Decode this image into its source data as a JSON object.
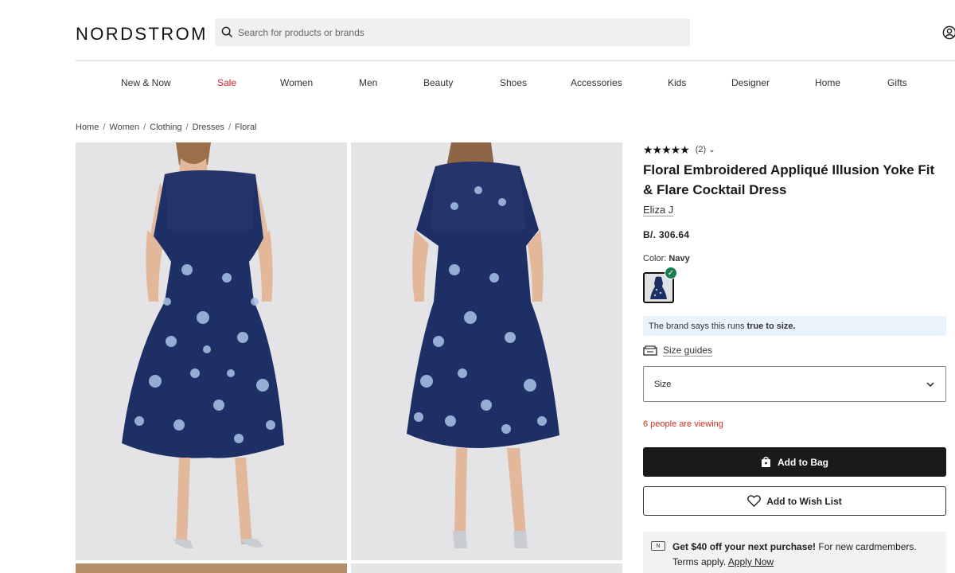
{
  "header": {
    "logo": "NORDSTROM",
    "search_placeholder": "Search for products or brands",
    "account_icon": "account-icon"
  },
  "nav": [
    "New & Now",
    "Sale",
    "Women",
    "Men",
    "Beauty",
    "Shoes",
    "Accessories",
    "Kids",
    "Designer",
    "Home",
    "Gifts"
  ],
  "breadcrumb": [
    "Home",
    "Women",
    "Clothing",
    "Dresses",
    "Floral"
  ],
  "breadcrumb_sep": "/",
  "product": {
    "stars": "★★★★★",
    "rating_value": 5,
    "review_count": "(2)",
    "title": "Floral Embroidered Appliqué Illusion Yoke Fit & Flare Cocktail Dress",
    "brand": "Eliza J",
    "price": "B/. 306.64",
    "color_label": "Color:",
    "color_value": "Navy",
    "fit_text": "The brand says this runs",
    "fit_bold": "true to size.",
    "size_guides": "Size guides",
    "size_select": "Size",
    "viewing": "6 people are viewing",
    "add_to_bag": "Add to Bag",
    "add_to_wishlist": "Add to Wish List"
  },
  "promo": {
    "card_letter": "N",
    "bold": "Get $40 off your next purchase!",
    "text": "For new cardmembers.",
    "terms": "Terms apply.",
    "link": "Apply Now"
  },
  "colors": {
    "sale": "#d5252c",
    "viewing": "#c8311f",
    "primary_button": "#191a1b",
    "fit_banner": "#eaf3fb",
    "check": "#1b7f52",
    "dress_navy": "#1e2f66"
  }
}
